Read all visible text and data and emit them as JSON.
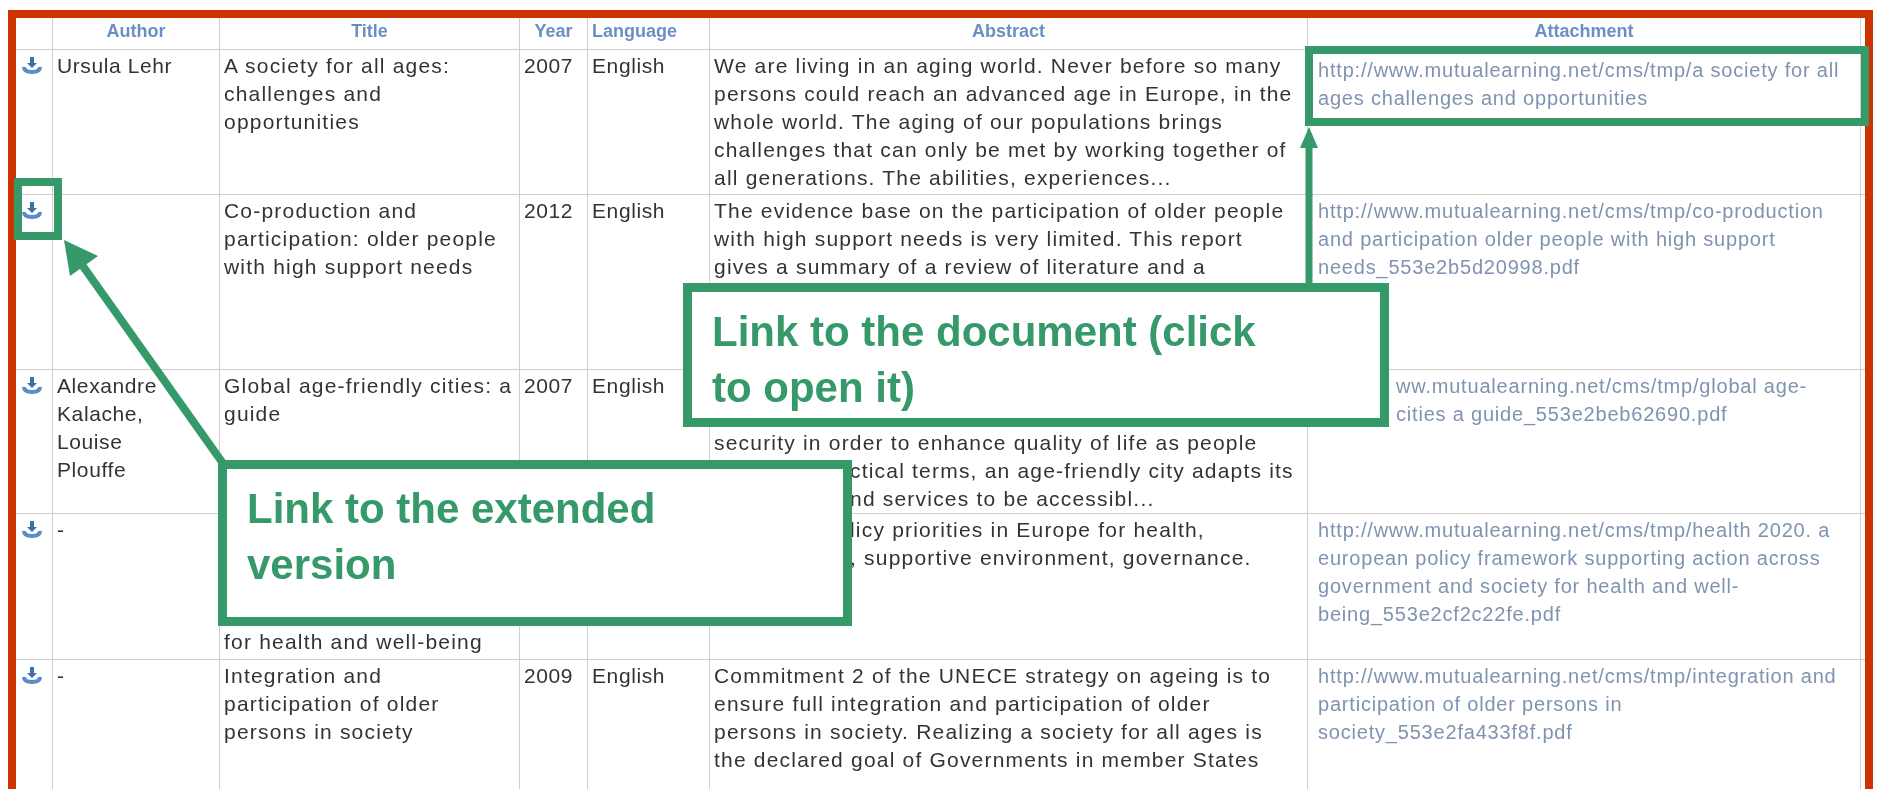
{
  "table": {
    "columns": [
      "Author",
      "Title",
      "Year",
      "Language",
      "Abstract",
      "Attachment"
    ],
    "rows": [
      {
        "author": "Ursula Lehr",
        "title": [
          "A society for all ages: challenges and opportunities"
        ],
        "year": "2007",
        "language": "English",
        "abstract": [
          "We are living in an aging world. Never before so many persons could reach an advanced age in Europe, in the whole world. The aging of our populations brings challenges that can only be met by working together of all generations. The abilities, experiences..."
        ],
        "attachment": [
          "http://www.mutualearning.net/cms/tmp/a society for all ages challenges and opportunities"
        ]
      },
      {
        "title": [
          "Co-production and participation: older people with high support needs"
        ],
        "year": "2012",
        "language": "English",
        "abstract": [
          "The evidence base on the participation of older people with high support needs is very limited. This report gives a summary of a review of literature and a"
        ],
        "attachment": [
          "http://www.mutualearning.net/cms/tmp/co-production and participation older people with high support needs_553e2b5d20998.pdf"
        ]
      },
      {
        "author": "Alexandre Kalache, Louise Plouffe",
        "title": [
          "Global age-friendly cities: a guide"
        ],
        "year": "2007",
        "language": "English",
        "abstract": [
          "security in order to enhance quality of life as people",
          "ctical terms, an age-friendly city adapts its",
          "nd services to be accessibl..."
        ],
        "attachment": [
          "ww.mutualearning.net/cms/tmp/global age-",
          "cities a guide_553e2beb62690.pdf"
        ]
      },
      {
        "author": "-",
        "title": [
          "for health and well-being"
        ],
        "abstract": [
          "licy priorities in Europe for health,",
          ", supportive environment, governance."
        ],
        "attachment": [
          "http://www.mutualearning.net/cms/tmp/health 2020. a european policy framework supporting action across government and society for health and well-being_553e2cf2c22fe.pdf"
        ]
      },
      {
        "author": "-",
        "title": [
          "Integration and participation of older persons in society"
        ],
        "year": "2009",
        "language": "English",
        "abstract": [
          "Commitment 2 of the UNECE strategy on ageing is to ensure full integration and participation of older persons in society. Realizing a society for all ages is the declared goal of Governments in member States"
        ],
        "attachment": [
          "http://www.mutualearning.net/cms/tmp/integration and participation of older persons in society_553e2fa433f8f.pdf"
        ]
      }
    ]
  },
  "callouts": [
    {
      "text": "Link to the document (click to open it)"
    },
    {
      "text": "Link to the extended version"
    }
  ]
}
